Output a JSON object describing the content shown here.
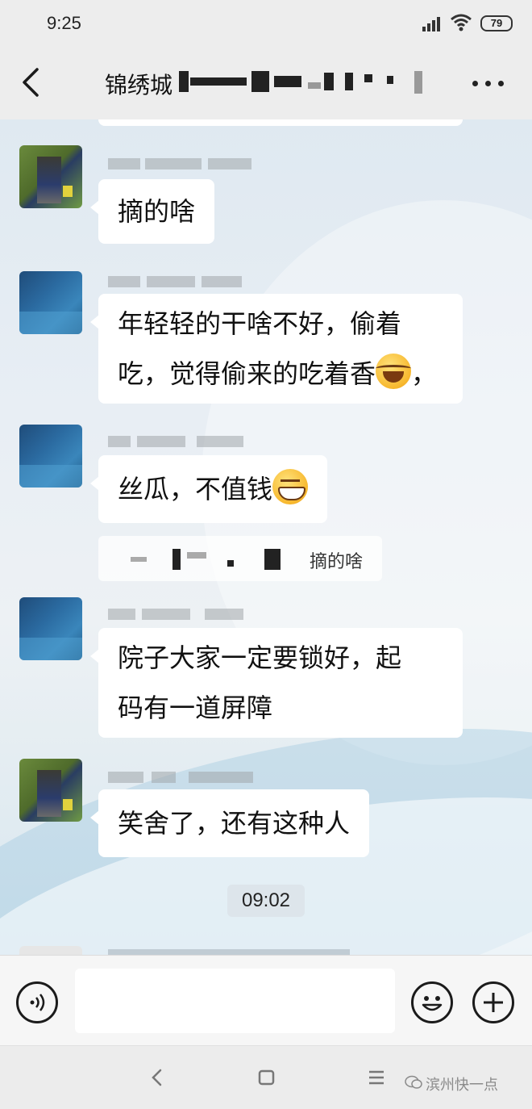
{
  "status_bar": {
    "time": "9:25",
    "battery": "79",
    "icons": [
      "signal-icon",
      "wifi-icon",
      "battery-icon"
    ]
  },
  "header": {
    "title": "锦绣城",
    "icons": [
      "back-arrow-icon",
      "more-dots-icon"
    ]
  },
  "messages": [
    {
      "sender": "",
      "avatar": "green-photo",
      "lines": [
        "摘的啥"
      ],
      "emoji": ""
    },
    {
      "sender": "",
      "avatar": "blue-photo",
      "lines": [
        "年轻轻的干啥不好，偷着",
        "吃，觉得偷来的吃着香",
        "，"
      ],
      "emoji": "face-with-tears-of-joy"
    },
    {
      "sender": "",
      "avatar": "blue-photo",
      "lines": [
        "丝瓜，不值钱"
      ],
      "emoji": "grinning-face"
    },
    {
      "sender": "",
      "avatar": "blue-photo",
      "lines": [
        "院子大家一定要锁好，起",
        "码有一道屏障"
      ],
      "emoji": ""
    },
    {
      "sender": "",
      "avatar": "green-photo",
      "lines": [
        "笑舍了，还有这种人"
      ],
      "emoji": ""
    }
  ],
  "quote": {
    "text": "摘的啥"
  },
  "time_divider": "09:02",
  "input_bar": {
    "value": "",
    "icons": [
      "voice-icon",
      "emoji-icon",
      "plus-icon"
    ]
  },
  "nav_bar": {
    "icons": [
      "nav-back-icon",
      "nav-home-icon",
      "nav-menu-icon"
    ],
    "watermark": "滨州快一点"
  },
  "colors": {
    "bubble": "#ffffff",
    "chrome": "#ededed",
    "text": "#111111"
  }
}
